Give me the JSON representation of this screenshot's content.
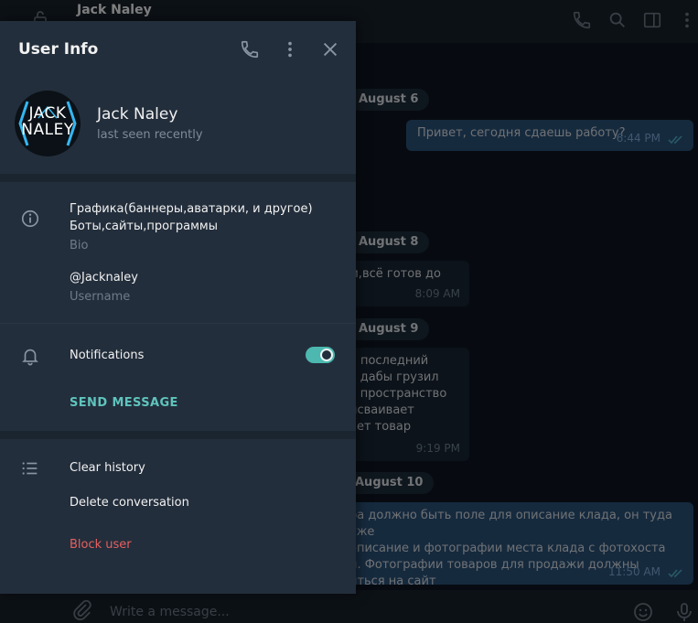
{
  "background": {
    "chat_peer": "Jack Naley",
    "composer_placeholder": "Write a message...",
    "dates": [
      "August 6",
      "August 8",
      "August 9",
      "August 10"
    ],
    "messages": [
      {
        "text": "Привет, сегодня сдаешь работу?",
        "time": "6:44 PM",
        "direction": "out"
      },
      {
        "text": "м,всё готов до",
        "time": "8:09 AM",
        "direction": "in"
      },
      {
        "lines": [
          "я последний",
          "ь дабы грузил",
          "в пространство",
          "исваивает",
          "ает товар"
        ],
        "time": "9:19 PM",
        "direction": "in"
      },
      {
        "lines": [
          "ра должно быть поле для описание клада, он туда уже",
          " описание и фотографии места клада с фотохоста",
          "й. Фотографии товаров для продажи должны",
          "иться на сайт"
        ],
        "time": "11:50 AM",
        "direction": "out"
      }
    ]
  },
  "panel": {
    "title": "User Info",
    "user": {
      "name": "Jack Naley",
      "status": "last seen recently",
      "avatar_text": [
        "JACK",
        "NALEY"
      ]
    },
    "bio": {
      "lines": [
        "Графика(баннеры,аватарки, и другое)",
        "Боты,сайты,программы"
      ],
      "label": "Bio"
    },
    "username": {
      "value": "@Jacknaley",
      "label": "Username"
    },
    "notifications": {
      "label": "Notifications",
      "enabled": true
    },
    "send_message": "SEND MESSAGE",
    "actions": {
      "clear_history": "Clear history",
      "delete_conversation": "Delete conversation",
      "block_user": "Block user"
    }
  },
  "colors": {
    "accent": "#5fc4bd",
    "danger": "#e46060",
    "panel_bg": "#232e3c",
    "chat_bg": "#0e1621"
  }
}
